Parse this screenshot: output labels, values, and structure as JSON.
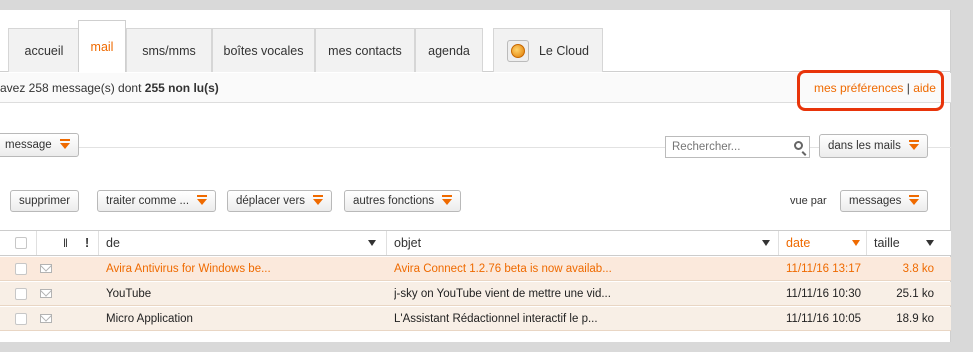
{
  "tabs": [
    {
      "label": "accueil"
    },
    {
      "label": "mail"
    },
    {
      "label": "sms/mms"
    },
    {
      "label": "boîtes vocales"
    },
    {
      "label": "mes contacts"
    },
    {
      "label": "agenda"
    },
    {
      "label": "Le Cloud"
    }
  ],
  "info": {
    "prefix": "avez 258 message(s) dont",
    "unread": "255 non lu(s)",
    "preferences": "mes préférences",
    "separator": "|",
    "help": "aide"
  },
  "toolbar1": {
    "new_message": "message",
    "search_placeholder": "Rechercher...",
    "search_scope": "dans les mails"
  },
  "toolbar2": {
    "delete": "supprimer",
    "treat_as": "traiter comme ...",
    "move_to": "déplacer vers",
    "other": "autres fonctions",
    "view_by_label": "vue par",
    "view_by": "messages"
  },
  "table": {
    "headers": {
      "from": "de",
      "subject": "objet",
      "date": "date",
      "size": "taille"
    },
    "rows": [
      {
        "from": "Avira Antivirus for Windows be...",
        "subject": "Avira Connect 1.2.76 beta is now availab...",
        "date": "11/11/16 13:17",
        "size": "3.8 ko",
        "unread": true
      },
      {
        "from": "YouTube",
        "subject": "j-sky on YouTube vient de mettre une vid...",
        "date": "11/11/16 10:30",
        "size": "25.1 ko",
        "unread": false
      },
      {
        "from": "Micro Application",
        "subject": "L'Assistant Rédactionnel interactif le p...",
        "date": "11/11/16 10:05",
        "size": "18.9 ko",
        "unread": false
      }
    ]
  },
  "colors": {
    "accent": "#ef6a00",
    "highlight_box": "#e8340a",
    "unread_row": "#fbe9dc"
  }
}
